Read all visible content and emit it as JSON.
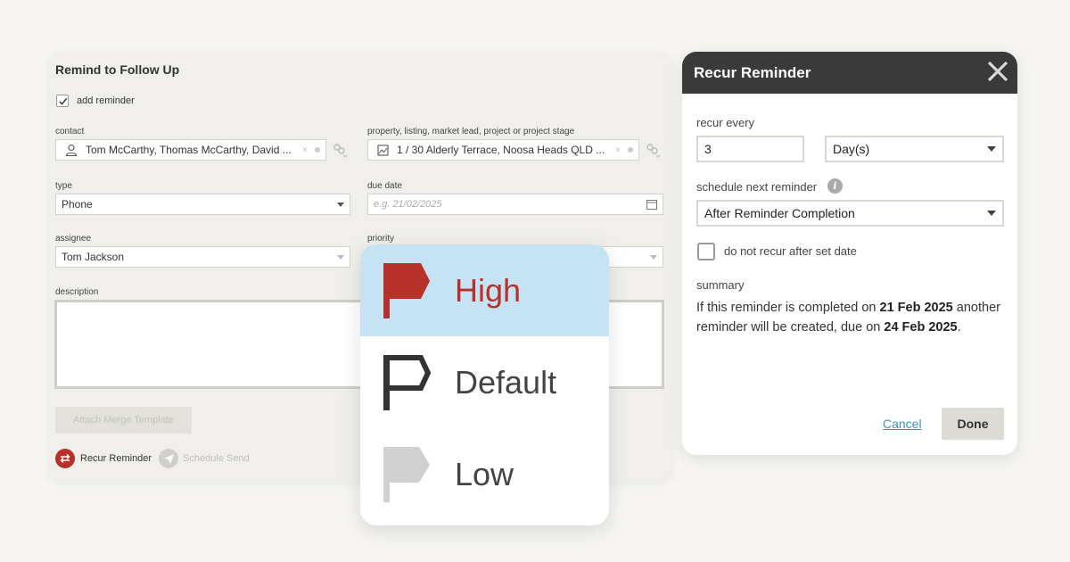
{
  "form": {
    "title": "Remind to Follow Up",
    "add_reminder_label": "add reminder",
    "add_reminder_checked": true,
    "contact_label": "contact",
    "contact_value": "Tom McCarthy, Thomas McCarthy, David ...",
    "property_label": "property, listing, market lead, project or project stage",
    "property_value": "1 / 30 Alderly Terrace, Noosa Heads QLD ...",
    "type_label": "type",
    "type_value": "Phone",
    "due_date_label": "due date",
    "due_date_placeholder": "e.g. 21/02/2025",
    "assignee_label": "assignee",
    "assignee_value": "Tom Jackson",
    "priority_label": "priority",
    "description_label": "description",
    "attach_button": "Attach Merge Template",
    "recur_reminder_label": "Recur Reminder",
    "schedule_send_label": "Schedule Send"
  },
  "priority_menu": {
    "selected": "High",
    "options": [
      {
        "label": "High",
        "color": "#b73128"
      },
      {
        "label": "Default",
        "color": "#333333"
      },
      {
        "label": "Low",
        "color": "#d0d0d0"
      }
    ]
  },
  "recur_dialog": {
    "title": "Recur Reminder",
    "recur_every_label": "recur every",
    "recur_every_value": "3",
    "unit_value": "Day(s)",
    "schedule_next_label": "schedule next reminder",
    "schedule_next_value": "After Reminder Completion",
    "do_not_recur_label": "do not recur after set date",
    "summary_label": "summary",
    "summary_part1": "If this reminder is completed on ",
    "summary_date1": "21 Feb 2025",
    "summary_part2": " another reminder will be created, due on ",
    "summary_date2": "24 Feb 2025",
    "summary_part3": ".",
    "cancel_label": "Cancel",
    "done_label": "Done"
  },
  "colors": {
    "accent_red": "#b73128",
    "selected_bg": "#c6e2f5",
    "header_dark": "#3a3a3a",
    "link_blue": "#3e8ec4"
  }
}
